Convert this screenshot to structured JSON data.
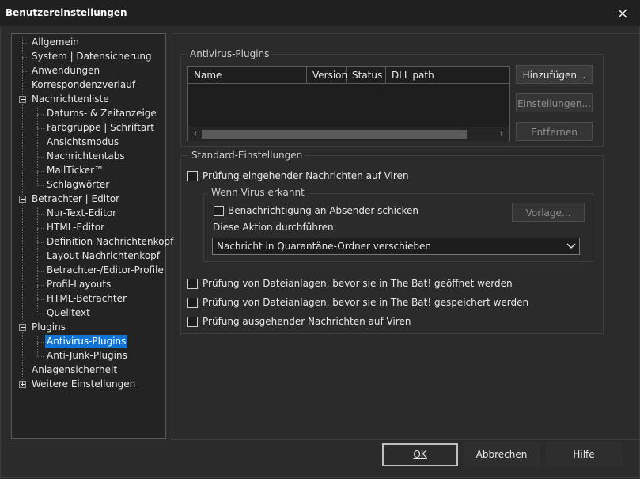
{
  "window": {
    "title": "Benutzereinstellungen",
    "close_icon": "close-icon"
  },
  "tree": {
    "items": [
      {
        "label": "Allgemein"
      },
      {
        "label": "System | Datensicherung"
      },
      {
        "label": "Anwendungen"
      },
      {
        "label": "Korrespondenzverlauf"
      },
      {
        "label": "Nachrichtenliste",
        "expander": "minus"
      },
      {
        "label": "Datums- & Zeitanzeige"
      },
      {
        "label": "Farbgruppe | Schriftart"
      },
      {
        "label": "Ansichtsmodus"
      },
      {
        "label": "Nachrichtentabs"
      },
      {
        "label": "MailTicker™"
      },
      {
        "label": "Schlagwörter"
      },
      {
        "label": "Betrachter | Editor",
        "expander": "minus"
      },
      {
        "label": "Nur-Text-Editor"
      },
      {
        "label": "HTML-Editor"
      },
      {
        "label": "Definition Nachrichtenkopf"
      },
      {
        "label": "Layout Nachrichtenkopf"
      },
      {
        "label": "Betrachter-/Editor-Profile"
      },
      {
        "label": "Profil-Layouts"
      },
      {
        "label": "HTML-Betrachter"
      },
      {
        "label": "Quelltext"
      },
      {
        "label": "Plugins",
        "expander": "minus"
      },
      {
        "label": "Antivirus-Plugins",
        "selected": true
      },
      {
        "label": "Anti-Junk-Plugins"
      },
      {
        "label": "Anlagensicherheit"
      },
      {
        "label": "Weitere Einstellungen",
        "expander": "plus"
      }
    ]
  },
  "antivirus": {
    "group_title": "Antivirus-Plugins",
    "columns": [
      "Name",
      "Version",
      "Status",
      "DLL path"
    ],
    "buttons": {
      "add": "Hinzufügen...",
      "settings": "Einstellungen...",
      "remove": "Entfernen"
    }
  },
  "standard": {
    "group_title": "Standard-Einstellungen",
    "check_incoming": "Prüfung eingehender Nachrichten auf Viren",
    "virus_group_title": "Wenn Virus erkannt",
    "notify_sender": "Benachrichtigung an Absender schicken",
    "template_button": "Vorlage...",
    "action_label": "Diese Aktion durchführen:",
    "action_value": "Nachricht in Quarantäne-Ordner verschieben",
    "check_attach_open": "Prüfung von Dateianlagen, bevor sie in The Bat! geöffnet werden",
    "check_attach_save": "Prüfung von Dateianlagen, bevor sie in The Bat! gespeichert werden",
    "check_outgoing": "Prüfung ausgehender Nachrichten auf Viren"
  },
  "footer": {
    "ok": "OK",
    "cancel": "Abbrechen",
    "help": "Hilfe"
  },
  "colors": {
    "selection": "#0f74d6",
    "background": "#2b2b2b",
    "titlebar": "#202020"
  }
}
